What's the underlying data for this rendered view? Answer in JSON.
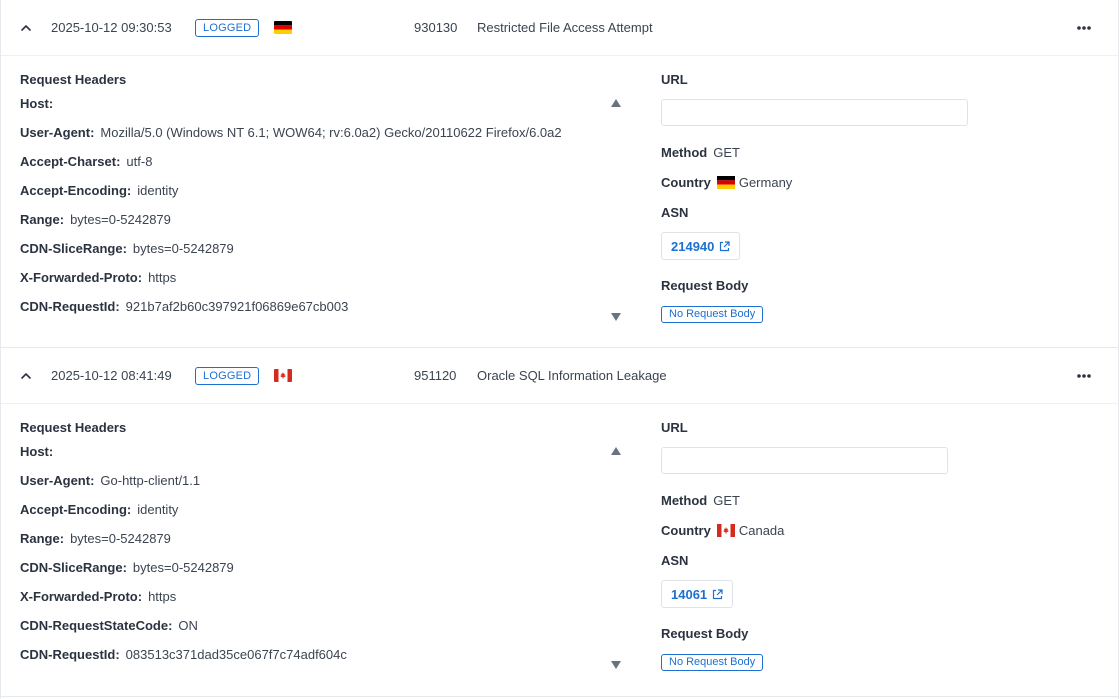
{
  "events": [
    {
      "timestamp": "2025-10-12 09:30:53",
      "status": "LOGGED",
      "flag": "germany-flag",
      "rule_id": "930130",
      "rule_name": "Restricted File Access Attempt",
      "headers_title": "Request Headers",
      "headers": [
        {
          "key": "Host:",
          "value": ""
        },
        {
          "key": "User-Agent:",
          "value": "Mozilla/5.0 (Windows NT 6.1; WOW64; rv:6.0a2) Gecko/20110622 Firefox/6.0a2"
        },
        {
          "key": "Accept-Charset:",
          "value": "utf-8"
        },
        {
          "key": "Accept-Encoding:",
          "value": "identity"
        },
        {
          "key": "Range:",
          "value": "bytes=0-5242879"
        },
        {
          "key": "CDN-SliceRange:",
          "value": "bytes=0-5242879"
        },
        {
          "key": "X-Forwarded-Proto:",
          "value": "https"
        },
        {
          "key": "CDN-RequestId:",
          "value": "921b7af2b60c397921f06869e67cb003"
        }
      ],
      "url_label": "URL",
      "url_value": "",
      "method_label": "Method",
      "method_value": "GET",
      "country_label": "Country",
      "country_value": "Germany",
      "asn_label": "ASN",
      "asn_value": "214940",
      "body_label": "Request Body",
      "body_value": "No Request Body"
    },
    {
      "timestamp": "2025-10-12 08:41:49",
      "status": "LOGGED",
      "flag": "canada-flag",
      "rule_id": "951120",
      "rule_name": "Oracle SQL Information Leakage",
      "headers_title": "Request Headers",
      "headers": [
        {
          "key": "Host:",
          "value": ""
        },
        {
          "key": "User-Agent:",
          "value": "Go-http-client/1.1"
        },
        {
          "key": "Accept-Encoding:",
          "value": "identity"
        },
        {
          "key": "Range:",
          "value": "bytes=0-5242879"
        },
        {
          "key": "CDN-SliceRange:",
          "value": "bytes=0-5242879"
        },
        {
          "key": "X-Forwarded-Proto:",
          "value": "https"
        },
        {
          "key": "CDN-RequestStateCode:",
          "value": "ON"
        },
        {
          "key": "CDN-RequestId:",
          "value": "083513c371dad35ce067f7c74adf604c"
        }
      ],
      "url_label": "URL",
      "url_value": "",
      "method_label": "Method",
      "method_value": "GET",
      "country_label": "Country",
      "country_value": "Canada",
      "asn_label": "ASN",
      "asn_value": "14061",
      "body_label": "Request Body",
      "body_value": "No Request Body"
    }
  ],
  "colors": {
    "accent": "#1d6fd1",
    "text": "#2b3340",
    "border": "#dfe3e8"
  }
}
